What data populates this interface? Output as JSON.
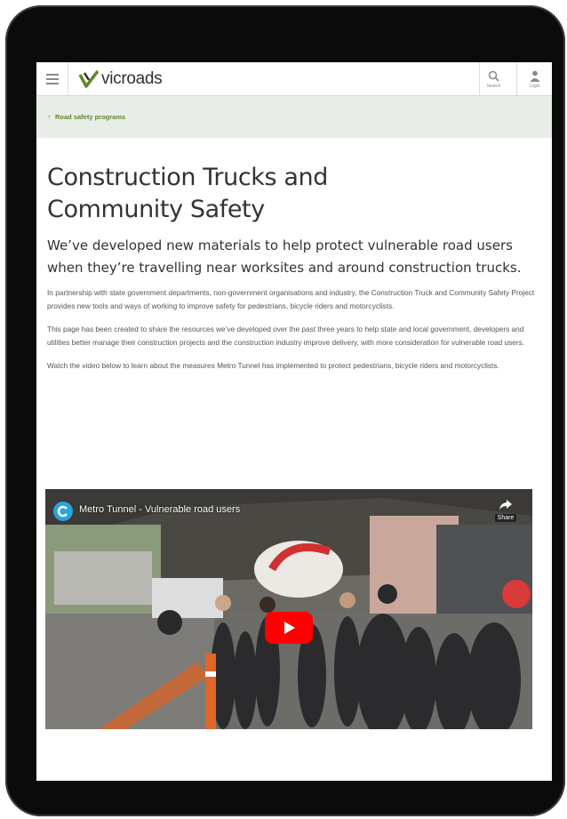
{
  "header": {
    "logo_text": "vicroads",
    "search_label": "Search",
    "login_label": "Login"
  },
  "breadcrumb": {
    "label": "Road safety programs"
  },
  "page": {
    "title_line1": "Construction Trucks and",
    "title_line2": "Community Safety",
    "lead": "We’ve developed new materials to help protect vulnerable road users when they’re travelling near worksites and around construction trucks.",
    "paragraphs": [
      "In partnership with state government departments, non-government organisations and industry, the Construction Truck and Community Safety Project provides new tools and ways of working to improve safety for pedestrians, bicycle riders and motorcyclists.",
      "This page has been created to share the resources we’ve developed over the past three years to help state and local government, developers and utilities better manage their construction projects and the construction industry improve delivery, with more consideration for vulnerable road users.",
      "Watch the video below to learn about the measures Metro Tunnel has implemented to protect pedestrians, bicycle riders and motorcyclists."
    ]
  },
  "video": {
    "title": "Metro Tunnel - Vulnerable road users",
    "share_label": "Share"
  },
  "colors": {
    "brand_green": "#5e8a2b",
    "breadcrumb_bg": "#e9ede8",
    "play_red": "#ff0000"
  },
  "icons": [
    "menu-icon",
    "vicroads-logo-icon",
    "search-icon",
    "user-icon",
    "metro-tunnel-logo-icon",
    "share-icon",
    "play-icon",
    "back-arrow-icon"
  ]
}
